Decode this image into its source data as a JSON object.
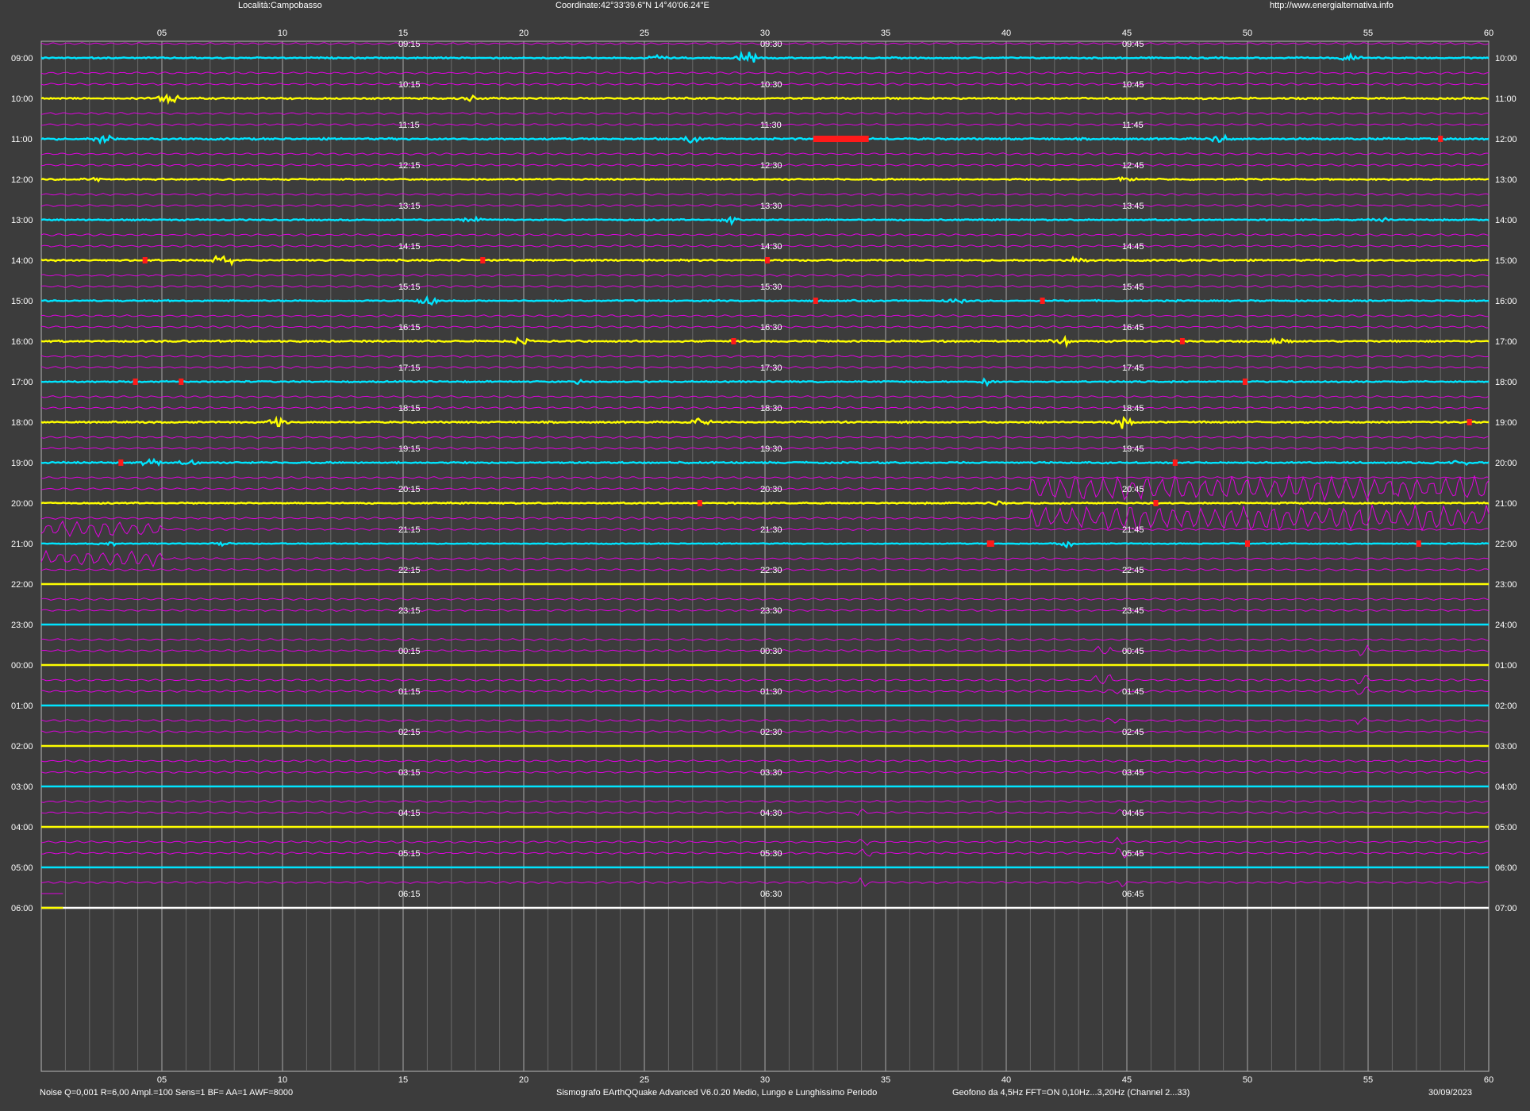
{
  "header": {
    "location": "Località:Campobasso",
    "coordinates": "Coordinate:42°33'39.6\"N  14°40'06.24\"E",
    "url": "http://www.energialternativa.info"
  },
  "footer": {
    "params": "Noise Q=0,001 R=6,00 Ampl.=100 Sens=1 BF= AA=1 AWF=8000",
    "software": "Sismografo  EArthQQuake Advanced V6.0.20  Medio, Lungo e Lunghissimo Periodo",
    "sensor": "Geofono da 4,5Hz FFT=ON 0,10Hz...3,20Hz      (Channel 2...33)",
    "date": "30/09/2023"
  },
  "chart_data": {
    "type": "line",
    "x_unit": "minutes",
    "xlim": [
      0,
      60
    ],
    "x_ticks": [
      "05",
      "10",
      "15",
      "20",
      "25",
      "30",
      "35",
      "40",
      "45",
      "50",
      "55",
      "60"
    ],
    "colors": {
      "background": "#3c3c3c",
      "cyan": "#00e5ff",
      "yellow": "#ffff00",
      "magenta": "#e000e0",
      "event": "#ff1a1a",
      "grid": "#9a9a9a"
    },
    "rows": [
      {
        "left": "09:00",
        "right": "10:00",
        "quarters": [
          "09:15",
          "09:30",
          "09:45"
        ],
        "color": "cyan",
        "level": 0.6,
        "bursts": [
          {
            "x": 25.5,
            "a": 0.9
          },
          {
            "x": 29.3,
            "a": 2.5
          },
          {
            "x": 54.3,
            "a": 1.2
          }
        ],
        "events": [],
        "mag_activity": []
      },
      {
        "left": "10:00",
        "right": "11:00",
        "quarters": [
          "10:15",
          "10:30",
          "10:45"
        ],
        "color": "yellow",
        "level": 0.7,
        "bursts": [
          {
            "x": 4.8,
            "a": 1.0
          },
          {
            "x": 5.4,
            "a": 1.5
          },
          {
            "x": 17.8,
            "a": 0.8
          }
        ],
        "events": [],
        "mag_activity": []
      },
      {
        "left": "11:00",
        "right": "12:00",
        "quarters": [
          "11:15",
          "11:30",
          "11:45"
        ],
        "color": "cyan",
        "level": 0.8,
        "bursts": [
          {
            "x": 2.6,
            "a": 1.5
          },
          {
            "x": 27.0,
            "a": 1.0
          },
          {
            "x": 48.9,
            "a": 1.5
          }
        ],
        "events": [
          {
            "x0": 32.0,
            "x1": 34.3
          },
          {
            "x0": 57.9,
            "x1": 58.1
          }
        ],
        "mag_activity": []
      },
      {
        "left": "12:00",
        "right": "13:00",
        "quarters": [
          "12:15",
          "12:30",
          "12:45"
        ],
        "color": "yellow",
        "level": 0.6,
        "bursts": [
          {
            "x": 2.1,
            "a": 0.8
          },
          {
            "x": 45.0,
            "a": 0.8
          }
        ],
        "events": [],
        "mag_activity": []
      },
      {
        "left": "13:00",
        "right": "14:00",
        "quarters": [
          "13:15",
          "13:30",
          "13:45"
        ],
        "color": "cyan",
        "level": 0.6,
        "bursts": [
          {
            "x": 17.9,
            "a": 0.9
          },
          {
            "x": 28.6,
            "a": 1.2
          },
          {
            "x": 55.5,
            "a": 1.0
          }
        ],
        "events": [],
        "mag_activity": []
      },
      {
        "left": "14:00",
        "right": "15:00",
        "quarters": [
          "14:15",
          "14:30",
          "14:45"
        ],
        "color": "yellow",
        "level": 0.7,
        "bursts": [
          {
            "x": 7.5,
            "a": 2.5
          },
          {
            "x": 42.8,
            "a": 1.0
          }
        ],
        "events": [
          {
            "x0": 4.2,
            "x1": 4.4
          },
          {
            "x0": 18.2,
            "x1": 18.4
          },
          {
            "x0": 30.0,
            "x1": 30.2
          }
        ],
        "mag_activity": []
      },
      {
        "left": "15:00",
        "right": "16:00",
        "quarters": [
          "15:15",
          "15:30",
          "15:45"
        ],
        "color": "cyan",
        "level": 0.6,
        "bursts": [
          {
            "x": 16.0,
            "a": 2.0
          },
          {
            "x": 38.0,
            "a": 0.8
          }
        ],
        "events": [
          {
            "x0": 32.0,
            "x1": 32.1
          },
          {
            "x0": 41.4,
            "x1": 41.6
          }
        ],
        "mag_activity": []
      },
      {
        "left": "16:00",
        "right": "17:00",
        "quarters": [
          "16:15",
          "16:30",
          "16:45"
        ],
        "color": "yellow",
        "level": 0.7,
        "bursts": [
          {
            "x": 20.0,
            "a": 1.0
          },
          {
            "x": 42.3,
            "a": 1.5
          },
          {
            "x": 51.4,
            "a": 1.0
          }
        ],
        "events": [
          {
            "x0": 28.6,
            "x1": 28.8
          },
          {
            "x0": 47.2,
            "x1": 47.3
          }
        ],
        "mag_activity": []
      },
      {
        "left": "17:00",
        "right": "18:00",
        "quarters": [
          "17:15",
          "17:30",
          "17:45"
        ],
        "color": "cyan",
        "level": 0.6,
        "bursts": [
          {
            "x": 22.3,
            "a": 0.8
          },
          {
            "x": 39.1,
            "a": 1.6
          }
        ],
        "events": [
          {
            "x0": 3.8,
            "x1": 4.0
          },
          {
            "x0": 5.7,
            "x1": 5.8
          },
          {
            "x0": 49.8,
            "x1": 49.9
          }
        ],
        "mag_activity": []
      },
      {
        "left": "18:00",
        "right": "19:00",
        "quarters": [
          "18:15",
          "18:30",
          "18:45"
        ],
        "color": "yellow",
        "level": 0.7,
        "bursts": [
          {
            "x": 9.8,
            "a": 1.8
          },
          {
            "x": 27.3,
            "a": 1.0
          },
          {
            "x": 44.9,
            "a": 2.0
          }
        ],
        "events": [
          {
            "x0": 59.1,
            "x1": 59.3
          }
        ],
        "mag_activity": []
      },
      {
        "left": "19:00",
        "right": "20:00",
        "quarters": [
          "19:15",
          "19:30",
          "19:45"
        ],
        "color": "cyan",
        "level": 0.7,
        "bursts": [
          {
            "x": 4.5,
            "a": 1.5
          },
          {
            "x": 6.1,
            "a": 1.2
          },
          {
            "x": 58.8,
            "a": 1.2
          }
        ],
        "events": [
          {
            "x0": 3.2,
            "x1": 3.4
          },
          {
            "x0": 46.9,
            "x1": 47.1
          }
        ],
        "mag_activity": []
      },
      {
        "left": "20:00",
        "right": "21:00",
        "quarters": [
          "20:15",
          "20:30",
          "20:45"
        ],
        "color": "yellow",
        "level": 0.6,
        "bursts": [
          {
            "x": 39.5,
            "a": 1.0
          }
        ],
        "events": [
          {
            "x0": 27.2,
            "x1": 27.3
          },
          {
            "x0": 46.1,
            "x1": 46.3
          }
        ],
        "mag_activity": [
          {
            "x0": 41.0,
            "x1": 60,
            "a": 14
          }
        ]
      },
      {
        "left": "21:00",
        "right": "22:00",
        "quarters": [
          "21:15",
          "21:30",
          "21:45"
        ],
        "color": "cyan",
        "level": 0.4,
        "bursts": [
          {
            "x": 2.7,
            "a": 1.0
          },
          {
            "x": 7.4,
            "a": 0.8
          },
          {
            "x": 42.5,
            "a": 0.8
          }
        ],
        "events": [
          {
            "x0": 39.2,
            "x1": 39.5
          },
          {
            "x0": 49.9,
            "x1": 50.1
          },
          {
            "x0": 57.0,
            "x1": 57.1
          }
        ],
        "mag_activity": [
          {
            "x0": 0,
            "x1": 5,
            "a": 9
          }
        ]
      },
      {
        "left": "22:00",
        "right": "23:00",
        "quarters": [
          "22:15",
          "22:30",
          "22:45"
        ],
        "color": "yellow",
        "level": 0,
        "bursts": [],
        "events": [],
        "mag_activity": []
      },
      {
        "left": "23:00",
        "right": "24:00",
        "quarters": [
          "23:15",
          "23:30",
          "23:45"
        ],
        "color": "cyan",
        "level": 0,
        "bursts": [],
        "events": [],
        "mag_activity": []
      },
      {
        "left": "00:00",
        "right": "01:00",
        "quarters": [
          "00:15",
          "00:30",
          "00:45"
        ],
        "color": "yellow",
        "level": 0,
        "bursts": [],
        "events": [],
        "mag_activity": [
          {
            "x0": 43.6,
            "x1": 44.4,
            "a": 6
          },
          {
            "x0": 54.5,
            "x1": 55.0,
            "a": 6
          }
        ]
      },
      {
        "left": "01:00",
        "right": "02:00",
        "quarters": [
          "01:15",
          "01:30",
          "01:45"
        ],
        "color": "cyan",
        "level": 0,
        "bursts": [],
        "events": [],
        "mag_activity": [
          {
            "x0": 44.0,
            "x1": 45.0,
            "a": 3
          },
          {
            "x0": 54.5,
            "x1": 55.0,
            "a": 5
          }
        ]
      },
      {
        "left": "02:00",
        "right": "03:00",
        "quarters": [
          "02:15",
          "02:30",
          "02:45"
        ],
        "color": "yellow",
        "level": 0,
        "bursts": [],
        "events": [],
        "mag_activity": []
      },
      {
        "left": "03:00",
        "right": "04:00",
        "quarters": [
          "03:15",
          "03:30",
          "03:45"
        ],
        "color": "cyan",
        "level": 0,
        "bursts": [],
        "events": [],
        "mag_activity": []
      },
      {
        "left": "04:00",
        "right": "05:00",
        "quarters": [
          "04:15",
          "04:30",
          "04:45"
        ],
        "color": "yellow",
        "level": 0,
        "bursts": [],
        "events": [],
        "mag_activity": [
          {
            "x0": 33.8,
            "x1": 34.3,
            "a": 5
          },
          {
            "x0": 44.5,
            "x1": 44.9,
            "a": 5
          }
        ]
      },
      {
        "left": "05:00",
        "right": "06:00",
        "quarters": [
          "05:15",
          "05:30",
          "05:45"
        ],
        "color": "cyan",
        "level": 0,
        "bursts": [],
        "events": [],
        "mag_activity": [
          {
            "x0": 33.9,
            "x1": 34.4,
            "a": 6
          },
          {
            "x0": 44.6,
            "x1": 45.0,
            "a": 6
          }
        ]
      },
      {
        "left": "06:00",
        "right": "07:00",
        "quarters": [
          "06:15",
          "06:30",
          "06:45"
        ],
        "color": "white",
        "level": 0,
        "bursts": [],
        "events": [],
        "mag_activity": []
      }
    ],
    "partial_trace": {
      "color": "yellow",
      "x_end": 0.9
    }
  }
}
